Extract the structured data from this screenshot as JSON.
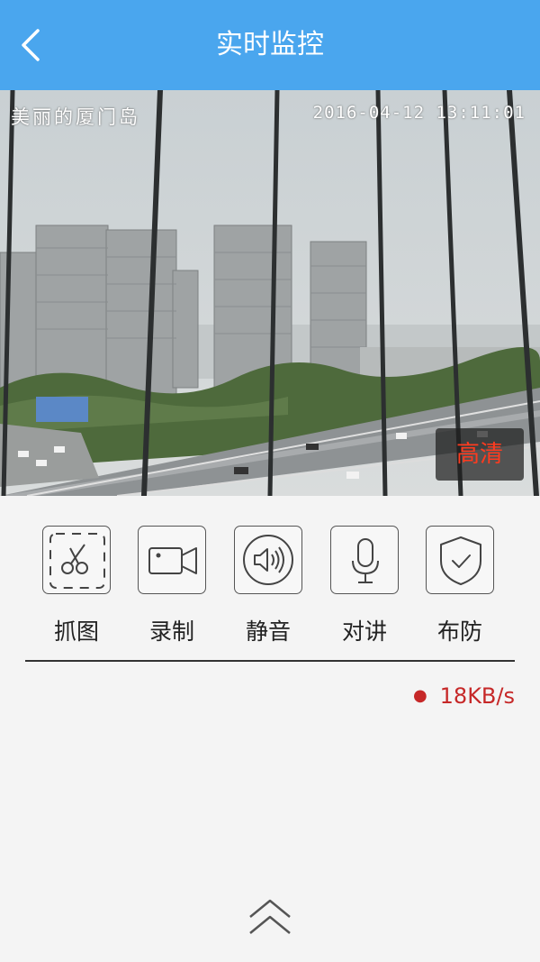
{
  "header": {
    "title": "实时监控",
    "back_icon": "chevron-left-icon"
  },
  "video": {
    "osd_location": "美丽的厦门岛",
    "osd_timestamp": "2016-04-12  13:11:01",
    "quality_button": "高清"
  },
  "toolbar": {
    "items": [
      {
        "label": "抓图",
        "icon": "scissors-icon"
      },
      {
        "label": "录制",
        "icon": "video-camera-icon"
      },
      {
        "label": "静音",
        "icon": "speaker-icon"
      },
      {
        "label": "对讲",
        "icon": "microphone-icon"
      },
      {
        "label": "布防",
        "icon": "shield-check-icon"
      }
    ]
  },
  "status": {
    "bitrate": "18KB/s"
  },
  "footer": {
    "collapse_icon": "double-chevron-up-icon"
  },
  "colors": {
    "header": "#4aa6ee",
    "accent_red": "#c62828",
    "hd_text": "#ff3b1f"
  }
}
